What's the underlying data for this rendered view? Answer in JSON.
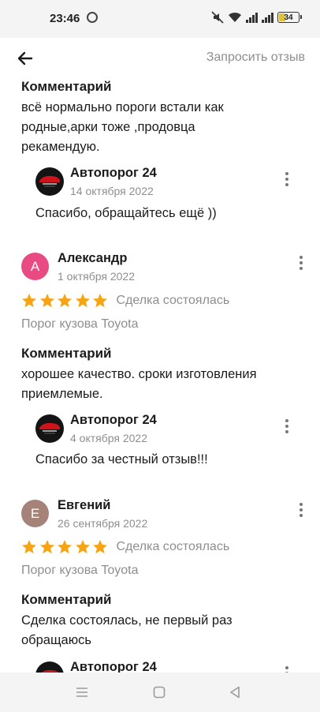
{
  "status_bar": {
    "time": "23:46",
    "battery": "34"
  },
  "header": {
    "request_review": "Запросить отзыв"
  },
  "comment_title": "Комментарий",
  "deal_status": "Сделка состоялась",
  "top_comment": {
    "lines": [
      "всё нормально пороги встали как",
      "родные,арки тоже ,продовца",
      "рекамендую."
    ],
    "reply": {
      "author": "Автопорог 24",
      "date": "14 октября 2022",
      "text": "Спасибо, обращайтесь ещё ))"
    }
  },
  "reviews": [
    {
      "initial": "А",
      "avatar_color": "#e94a82",
      "name": "Александр",
      "date": "1 октября 2022",
      "rating": 5,
      "product": "Порог кузова Toyota",
      "lines": [
        "хорошее качество. сроки изготовления",
        "приемлемые."
      ],
      "reply": {
        "author": "Автопорог 24",
        "date": "4 октября 2022",
        "text": "Спасибо за честный отзыв!!!"
      }
    },
    {
      "initial": "Е",
      "avatar_color": "#a58378",
      "name": "Евгений",
      "date": "26 сентября 2022",
      "rating": 5,
      "product": "Порог кузова Toyota",
      "lines": [
        "Сделка состоялась, не первый раз",
        "обращаюсь"
      ],
      "reply": {
        "author": "Автопорог 24"
      }
    }
  ],
  "colors": {
    "star": "#f7a414",
    "muted": "#8e8e8e"
  }
}
